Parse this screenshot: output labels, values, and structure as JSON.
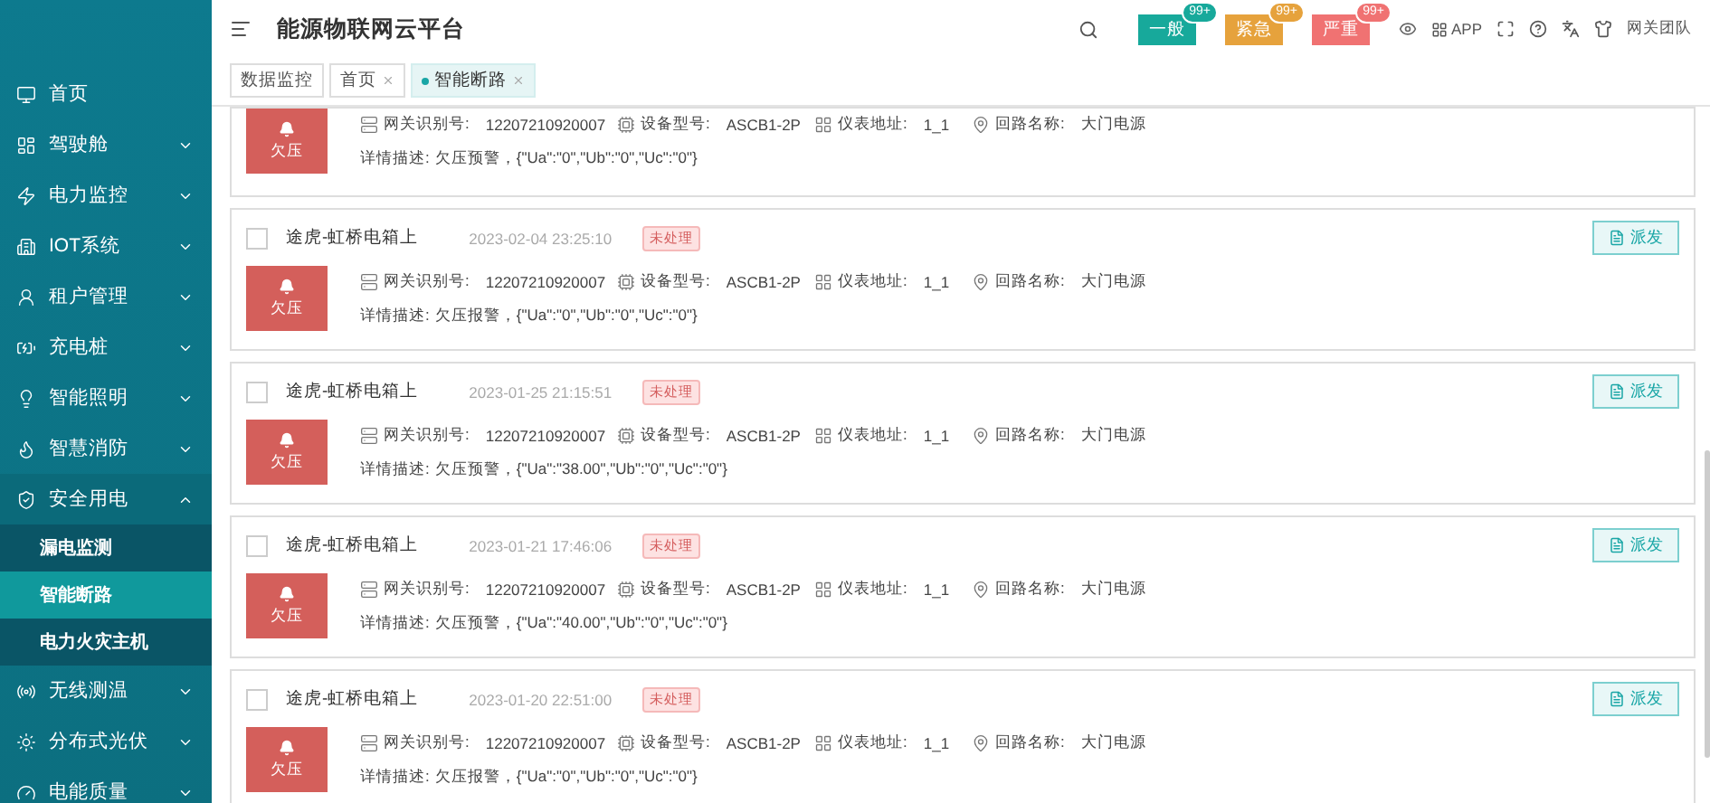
{
  "header": {
    "title": "能源物联网云平台",
    "badges": [
      {
        "label": "一般",
        "count": "99+",
        "color": "#17a99b"
      },
      {
        "label": "紧急",
        "count": "99+",
        "color": "#e6a23c"
      },
      {
        "label": "严重",
        "count": "99+",
        "color": "#f07272"
      }
    ],
    "app_label": "APP",
    "user": "网关团队"
  },
  "sidebar": {
    "items": [
      {
        "label": "首页"
      },
      {
        "label": "驾驶舱",
        "expanded": false
      },
      {
        "label": "电力监控",
        "expanded": false
      },
      {
        "label": "IOT系统",
        "expanded": false
      },
      {
        "label": "租户管理",
        "expanded": false
      },
      {
        "label": "充电桩",
        "expanded": false
      },
      {
        "label": "智能照明",
        "expanded": false
      },
      {
        "label": "智慧消防",
        "expanded": false
      },
      {
        "label": "安全用电",
        "expanded": true,
        "children": [
          {
            "label": "漏电监测",
            "selected": false
          },
          {
            "label": "智能断路",
            "selected": true
          },
          {
            "label": "电力火灾主机",
            "selected": false
          }
        ]
      },
      {
        "label": "无线测温",
        "expanded": false
      },
      {
        "label": "分布式光伏",
        "expanded": false
      },
      {
        "label": "电能质量",
        "expanded": false
      }
    ]
  },
  "tabs": [
    {
      "label": "数据监控",
      "selected": false,
      "closable": false
    },
    {
      "label": "首页",
      "selected": false,
      "closable": true
    },
    {
      "label": "智能断路",
      "selected": true,
      "closable": true
    }
  ],
  "alarms": [
    {
      "kind": "partial",
      "alarm_type": "欠压",
      "fields": [
        {
          "label": "网关识别号:",
          "value": "12207210920007"
        },
        {
          "label": "设备型号:",
          "value": "ASCB1-2P"
        },
        {
          "label": "仪表地址:",
          "value": "1_1"
        },
        {
          "label": "回路名称:",
          "value": "大门电源"
        }
      ],
      "description_label": "详情描述:",
      "description": "欠压预警，{\"Ua\":\"0\",\"Ub\":\"0\",\"Uc\":\"0\"}"
    },
    {
      "kind": "full",
      "checked": false,
      "location": "途虎-虹桥电箱上",
      "time": "2023-02-04 23:25:10",
      "status": "未处理",
      "action": "派发",
      "alarm_type": "欠压",
      "fields": [
        {
          "label": "网关识别号:",
          "value": "12207210920007"
        },
        {
          "label": "设备型号:",
          "value": "ASCB1-2P"
        },
        {
          "label": "仪表地址:",
          "value": "1_1"
        },
        {
          "label": "回路名称:",
          "value": "大门电源"
        }
      ],
      "description_label": "详情描述:",
      "description": "欠压报警，{\"Ua\":\"0\",\"Ub\":\"0\",\"Uc\":\"0\"}"
    },
    {
      "kind": "full",
      "checked": false,
      "location": "途虎-虹桥电箱上",
      "time": "2023-01-25 21:15:51",
      "status": "未处理",
      "action": "派发",
      "alarm_type": "欠压",
      "fields": [
        {
          "label": "网关识别号:",
          "value": "12207210920007"
        },
        {
          "label": "设备型号:",
          "value": "ASCB1-2P"
        },
        {
          "label": "仪表地址:",
          "value": "1_1"
        },
        {
          "label": "回路名称:",
          "value": "大门电源"
        }
      ],
      "description_label": "详情描述:",
      "description": "欠压预警，{\"Ua\":\"38.00\",\"Ub\":\"0\",\"Uc\":\"0\"}"
    },
    {
      "kind": "full",
      "checked": false,
      "location": "途虎-虹桥电箱上",
      "time": "2023-01-21 17:46:06",
      "status": "未处理",
      "action": "派发",
      "alarm_type": "欠压",
      "fields": [
        {
          "label": "网关识别号:",
          "value": "12207210920007"
        },
        {
          "label": "设备型号:",
          "value": "ASCB1-2P"
        },
        {
          "label": "仪表地址:",
          "value": "1_1"
        },
        {
          "label": "回路名称:",
          "value": "大门电源"
        }
      ],
      "description_label": "详情描述:",
      "description": "欠压预警，{\"Ua\":\"40.00\",\"Ub\":\"0\",\"Uc\":\"0\"}"
    },
    {
      "kind": "full",
      "checked": false,
      "location": "途虎-虹桥电箱上",
      "time": "2023-01-20 22:51:00",
      "status": "未处理",
      "action": "派发",
      "alarm_type": "欠压",
      "fields": [
        {
          "label": "网关识别号:",
          "value": "12207210920007"
        },
        {
          "label": "设备型号:",
          "value": "ASCB1-2P"
        },
        {
          "label": "仪表地址:",
          "value": "1_1"
        },
        {
          "label": "回路名称:",
          "value": "大门电源"
        }
      ],
      "description_label": "详情描述:",
      "description": "欠压报警，{\"Ua\":\"0\",\"Ub\":\"0\",\"Uc\":\"0\"}"
    }
  ]
}
